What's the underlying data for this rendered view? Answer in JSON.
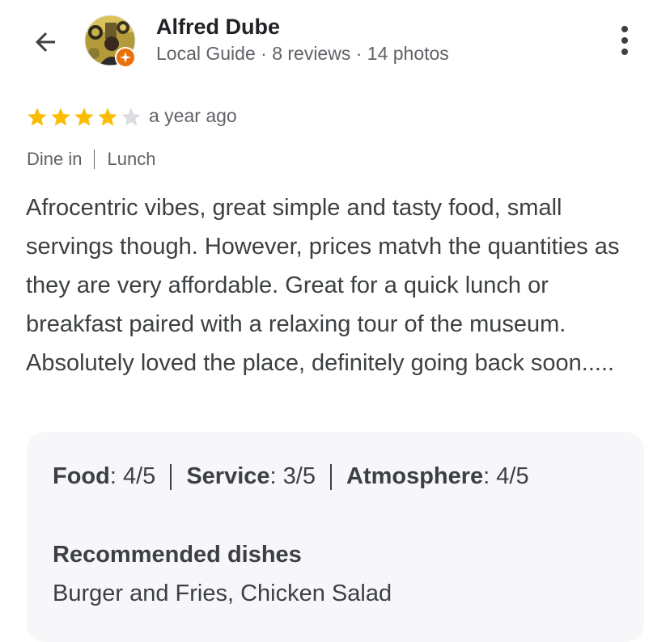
{
  "header": {
    "back_icon": "arrow-left-icon",
    "reviewer_name": "Alfred Dube",
    "reviewer_meta": "Local Guide · 8 reviews · 14 photos",
    "more_icon": "more-vertical-icon",
    "local_guide_badge_color": "#e8710a"
  },
  "review": {
    "rating": 4,
    "rating_max": 5,
    "star_color": "#fbbc04",
    "empty_star_color": "#dadce0",
    "date": "a year ago",
    "tags": [
      "Dine in",
      "Lunch"
    ],
    "text": "Afrocentric vibes, great simple and tasty food, small servings though. However, prices matvh the quantities as they are very affordable. Great for a quick lunch or breakfast paired with a relaxing tour of the museum. Absolutely loved the place, definitely going back soon....."
  },
  "details": {
    "ratings": [
      {
        "label": "Food",
        "value": "4/5"
      },
      {
        "label": "Service",
        "value": "3/5"
      },
      {
        "label": "Atmosphere",
        "value": "4/5"
      }
    ],
    "recommended_title": "Recommended dishes",
    "recommended_dishes": "Burger and Fries, Chicken Salad"
  }
}
